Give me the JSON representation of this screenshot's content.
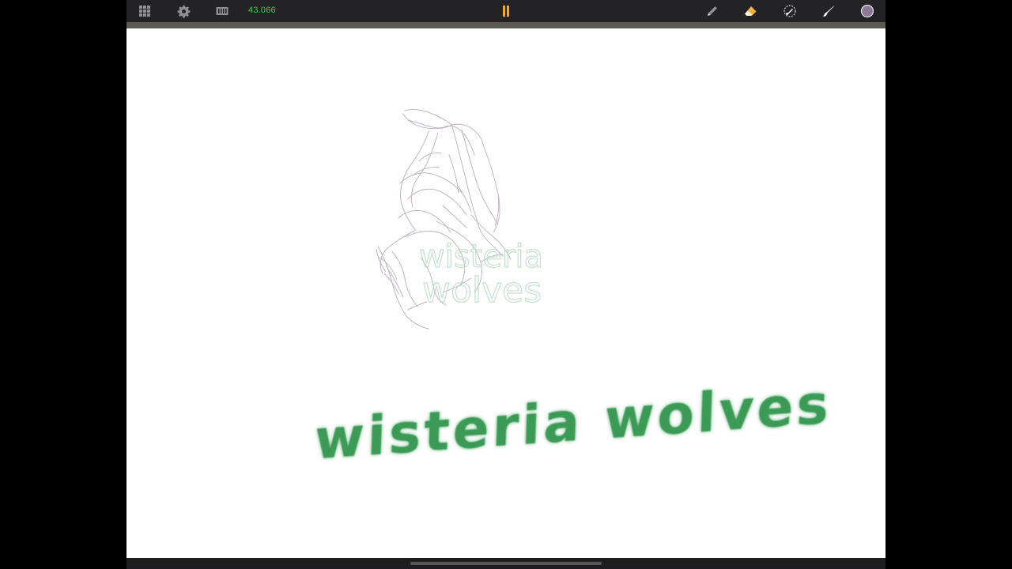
{
  "toolbar": {
    "timer": "43.066",
    "left_icons": [
      "grid-icon",
      "gear-icon",
      "filmstrip-icon"
    ],
    "center_icon": "pause-icon",
    "right_icons": [
      "pencil-icon",
      "eraser-icon",
      "brush-settings-icon",
      "paint-brush-icon",
      "color-swatch-icon"
    ]
  },
  "colors": {
    "timer": "#35d04a",
    "pause": "#f6a623",
    "eraser": "#f5b342",
    "current_color": "#8d7897",
    "ink_green": "#3b9b56",
    "sketch_lines": "#b7a9bc",
    "sketch_text": "#cfe3d4"
  },
  "canvas": {
    "title_text": "wisteria wolves",
    "sketch_text_line1": "wisteria",
    "sketch_text_line2": "wolves"
  }
}
